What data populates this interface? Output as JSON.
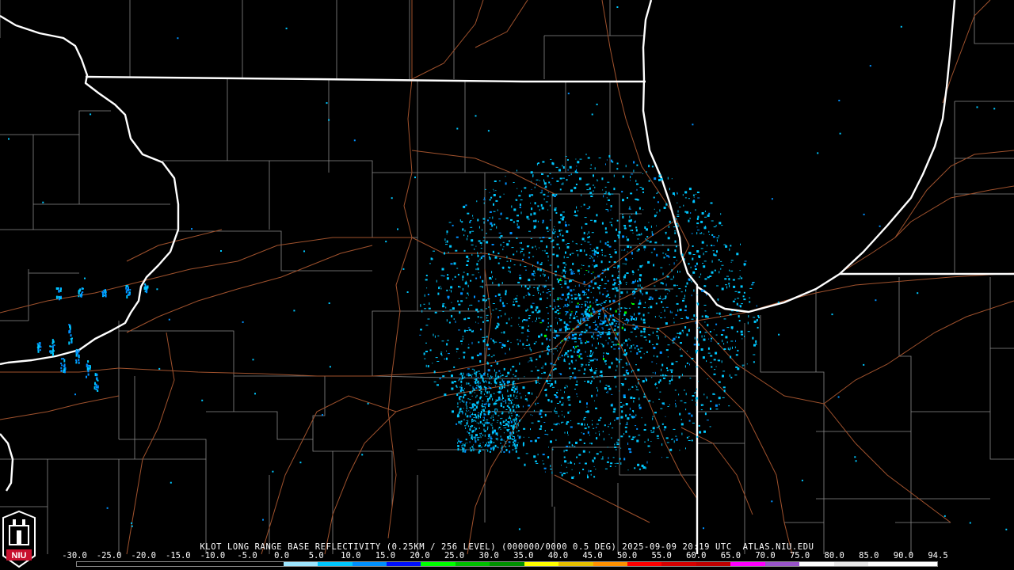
{
  "caption": "KLOT LONG RANGE BASE REFLECTIVITY (0.25KM / 256 LEVEL) (000000/0000 0.5 DEG) 2025-09-09 20:19 UTC  ATLAS.NIU.EDU",
  "logo_text": "NIU",
  "colorbar": {
    "ticks": [
      "-30.0",
      "-25.0",
      "-20.0",
      "-15.0",
      "-10.0",
      "-5.0",
      "0.0",
      "5.0",
      "10.0",
      "15.0",
      "20.0",
      "25.0",
      "30.0",
      "35.0",
      "40.0",
      "45.0",
      "50.0",
      "55.0",
      "60.0",
      "65.0",
      "70.0",
      "75.0",
      "80.0",
      "85.0",
      "90.0",
      "94.5"
    ],
    "colors": [
      "#000000",
      "#000000",
      "#000000",
      "#000000",
      "#000000",
      "#000000",
      "#9ee6ff",
      "#00c8ff",
      "#0090ff",
      "#0010ff",
      "#00ff00",
      "#00c000",
      "#009000",
      "#ffff00",
      "#e6c000",
      "#ff9000",
      "#ff0000",
      "#d60000",
      "#c00000",
      "#ff00ff",
      "#9955c9",
      "#ffffff",
      "#e8e8e8",
      "#ffffff",
      "#ffffff"
    ]
  },
  "colors": {
    "background": "#000000",
    "state_border": "#ffffff",
    "county_line": "#8a8a8a",
    "highway": "#a0522d",
    "echo_light": "#00c8ff",
    "echo_mid": "#0090ff",
    "echo_strong": "#00ff00"
  }
}
